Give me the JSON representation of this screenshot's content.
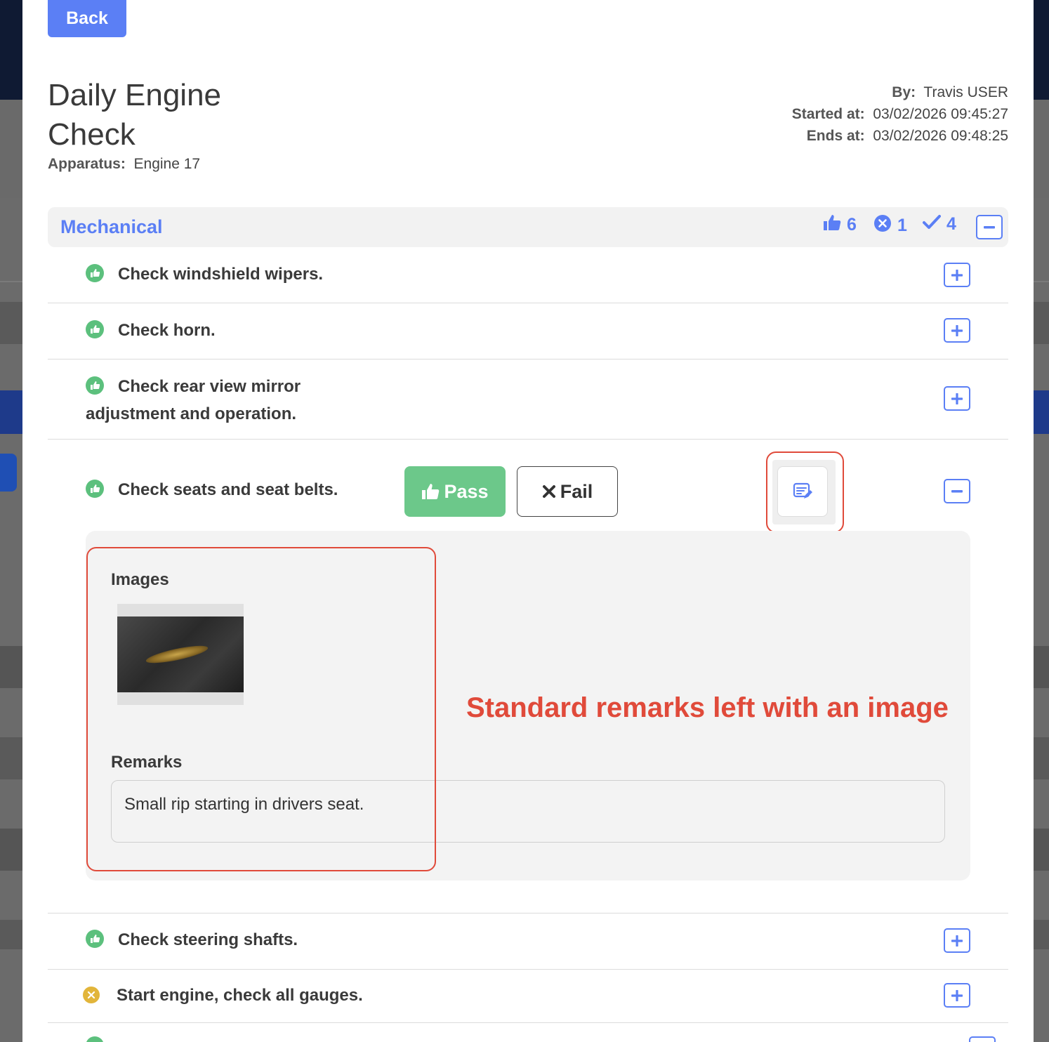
{
  "header": {
    "back_label": "Back",
    "title": "Daily Engine Check",
    "apparatus_label": "Apparatus:",
    "apparatus_value": "Engine 17",
    "by_label": "By:",
    "by_value": "Travis USER",
    "started_label": "Started at:",
    "started_value": "03/02/2026 09:45:27",
    "ends_label": "Ends at:",
    "ends_value": "03/02/2026 09:48:25"
  },
  "section": {
    "title": "Mechanical",
    "pass_count": "6",
    "fail_count": "1",
    "complete_count": "4"
  },
  "items": [
    {
      "label": "Check windshield wipers.",
      "status": "pass"
    },
    {
      "label": "Check horn.",
      "status": "pass"
    },
    {
      "label": "Check rear view mirror adjustment and operation.",
      "status": "pass"
    },
    {
      "label": "Check seats and seat belts.",
      "status": "pass"
    },
    {
      "label": "Check steering shafts.",
      "status": "pass"
    },
    {
      "label": "Start engine, check all gauges.",
      "status": "fail"
    }
  ],
  "expanded": {
    "pass_label": "Pass",
    "fail_label": "Fail",
    "images_heading": "Images",
    "remarks_heading": "Remarks",
    "remarks_text": "Small rip starting in drivers seat."
  },
  "annotation": {
    "text": "Standard remarks left with an image"
  },
  "colors": {
    "accent": "#5b7ff5",
    "pass": "#5cc07d",
    "fail": "#e2b53a",
    "annotation": "#e04a3a"
  }
}
